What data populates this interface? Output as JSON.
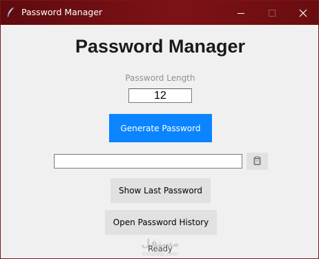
{
  "window": {
    "title": "Password Manager",
    "titlebar_color": "#6a0d10"
  },
  "app": {
    "heading": "Password Manager",
    "length_label": "Password Length",
    "length_value": "12",
    "generate_label": "Generate Password",
    "password_value": "",
    "copy_icon": "clipboard-icon",
    "show_last_label": "Show Last Password",
    "open_history_label": "Open Password History",
    "status": "Ready",
    "accent_color": "#0a84ff"
  },
  "watermark": {
    "arabic": "مستقل",
    "latin": "mostaql.com"
  }
}
